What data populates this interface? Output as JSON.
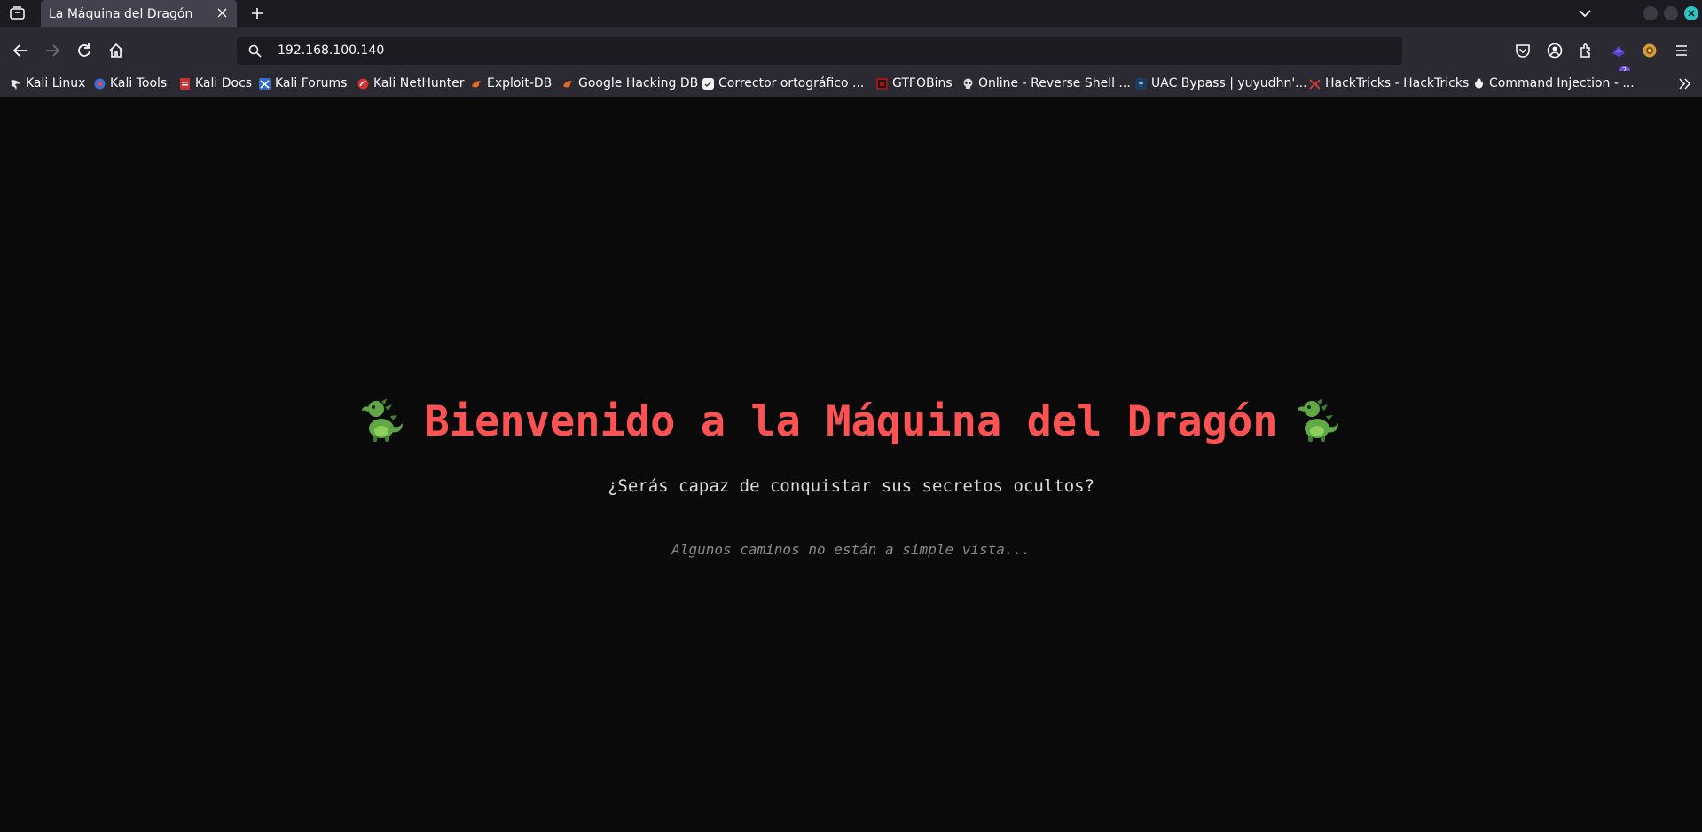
{
  "browser": {
    "tab": {
      "title": "La Máquina del Dragón",
      "icons": [
        "tab-list-icon",
        "close-icon",
        "plus-icon",
        "chevron-down-icon"
      ]
    },
    "address_bar": {
      "url": "192.168.100.140"
    },
    "toolbar_icons": [
      "back-icon",
      "forward-icon",
      "reload-icon",
      "home-icon",
      "pocket-icon",
      "account-icon",
      "extensions-icon",
      "hat-extension-icon",
      "menu-icon"
    ],
    "extension_badge": "2",
    "bookmarks": [
      {
        "label": "Kali Linux",
        "icon": "kali-dragon-icon"
      },
      {
        "label": "Kali Tools",
        "icon": "kali-tools-icon"
      },
      {
        "label": "Kali Docs",
        "icon": "kali-docs-icon"
      },
      {
        "label": "Kali Forums",
        "icon": "kali-forums-icon"
      },
      {
        "label": "Kali NetHunter",
        "icon": "nethunter-icon"
      },
      {
        "label": "Exploit-DB",
        "icon": "exploit-db-icon"
      },
      {
        "label": "Google Hacking DB",
        "icon": "ghdb-icon"
      },
      {
        "label": "Corrector ortográfico ...",
        "icon": "spellcheck-icon"
      },
      {
        "label": "GTFOBins",
        "icon": "gtfobins-icon"
      },
      {
        "label": "Online - Reverse Shell ...",
        "icon": "skull-icon"
      },
      {
        "label": "UAC Bypass | yuyudhn'...",
        "icon": "uac-icon"
      },
      {
        "label": "HackTricks - HackTricks",
        "icon": "hacktricks-icon"
      },
      {
        "label": "Command Injection - ...",
        "icon": "command-injection-icon"
      }
    ]
  },
  "page": {
    "title": "Bienvenido a la Máquina del Dragón",
    "subtitle": "¿Serás capaz de conquistar sus secretos ocultos?",
    "hint": "Algunos caminos no están a simple vista..."
  },
  "colors": {
    "background": "#0a0a0b",
    "title": "#ff5252",
    "subtitle": "#d9d9d9",
    "hint": "#8a8a8a",
    "chrome_dark": "#1c1b22",
    "chrome": "#2b2a33",
    "tab_active": "#42414d"
  }
}
